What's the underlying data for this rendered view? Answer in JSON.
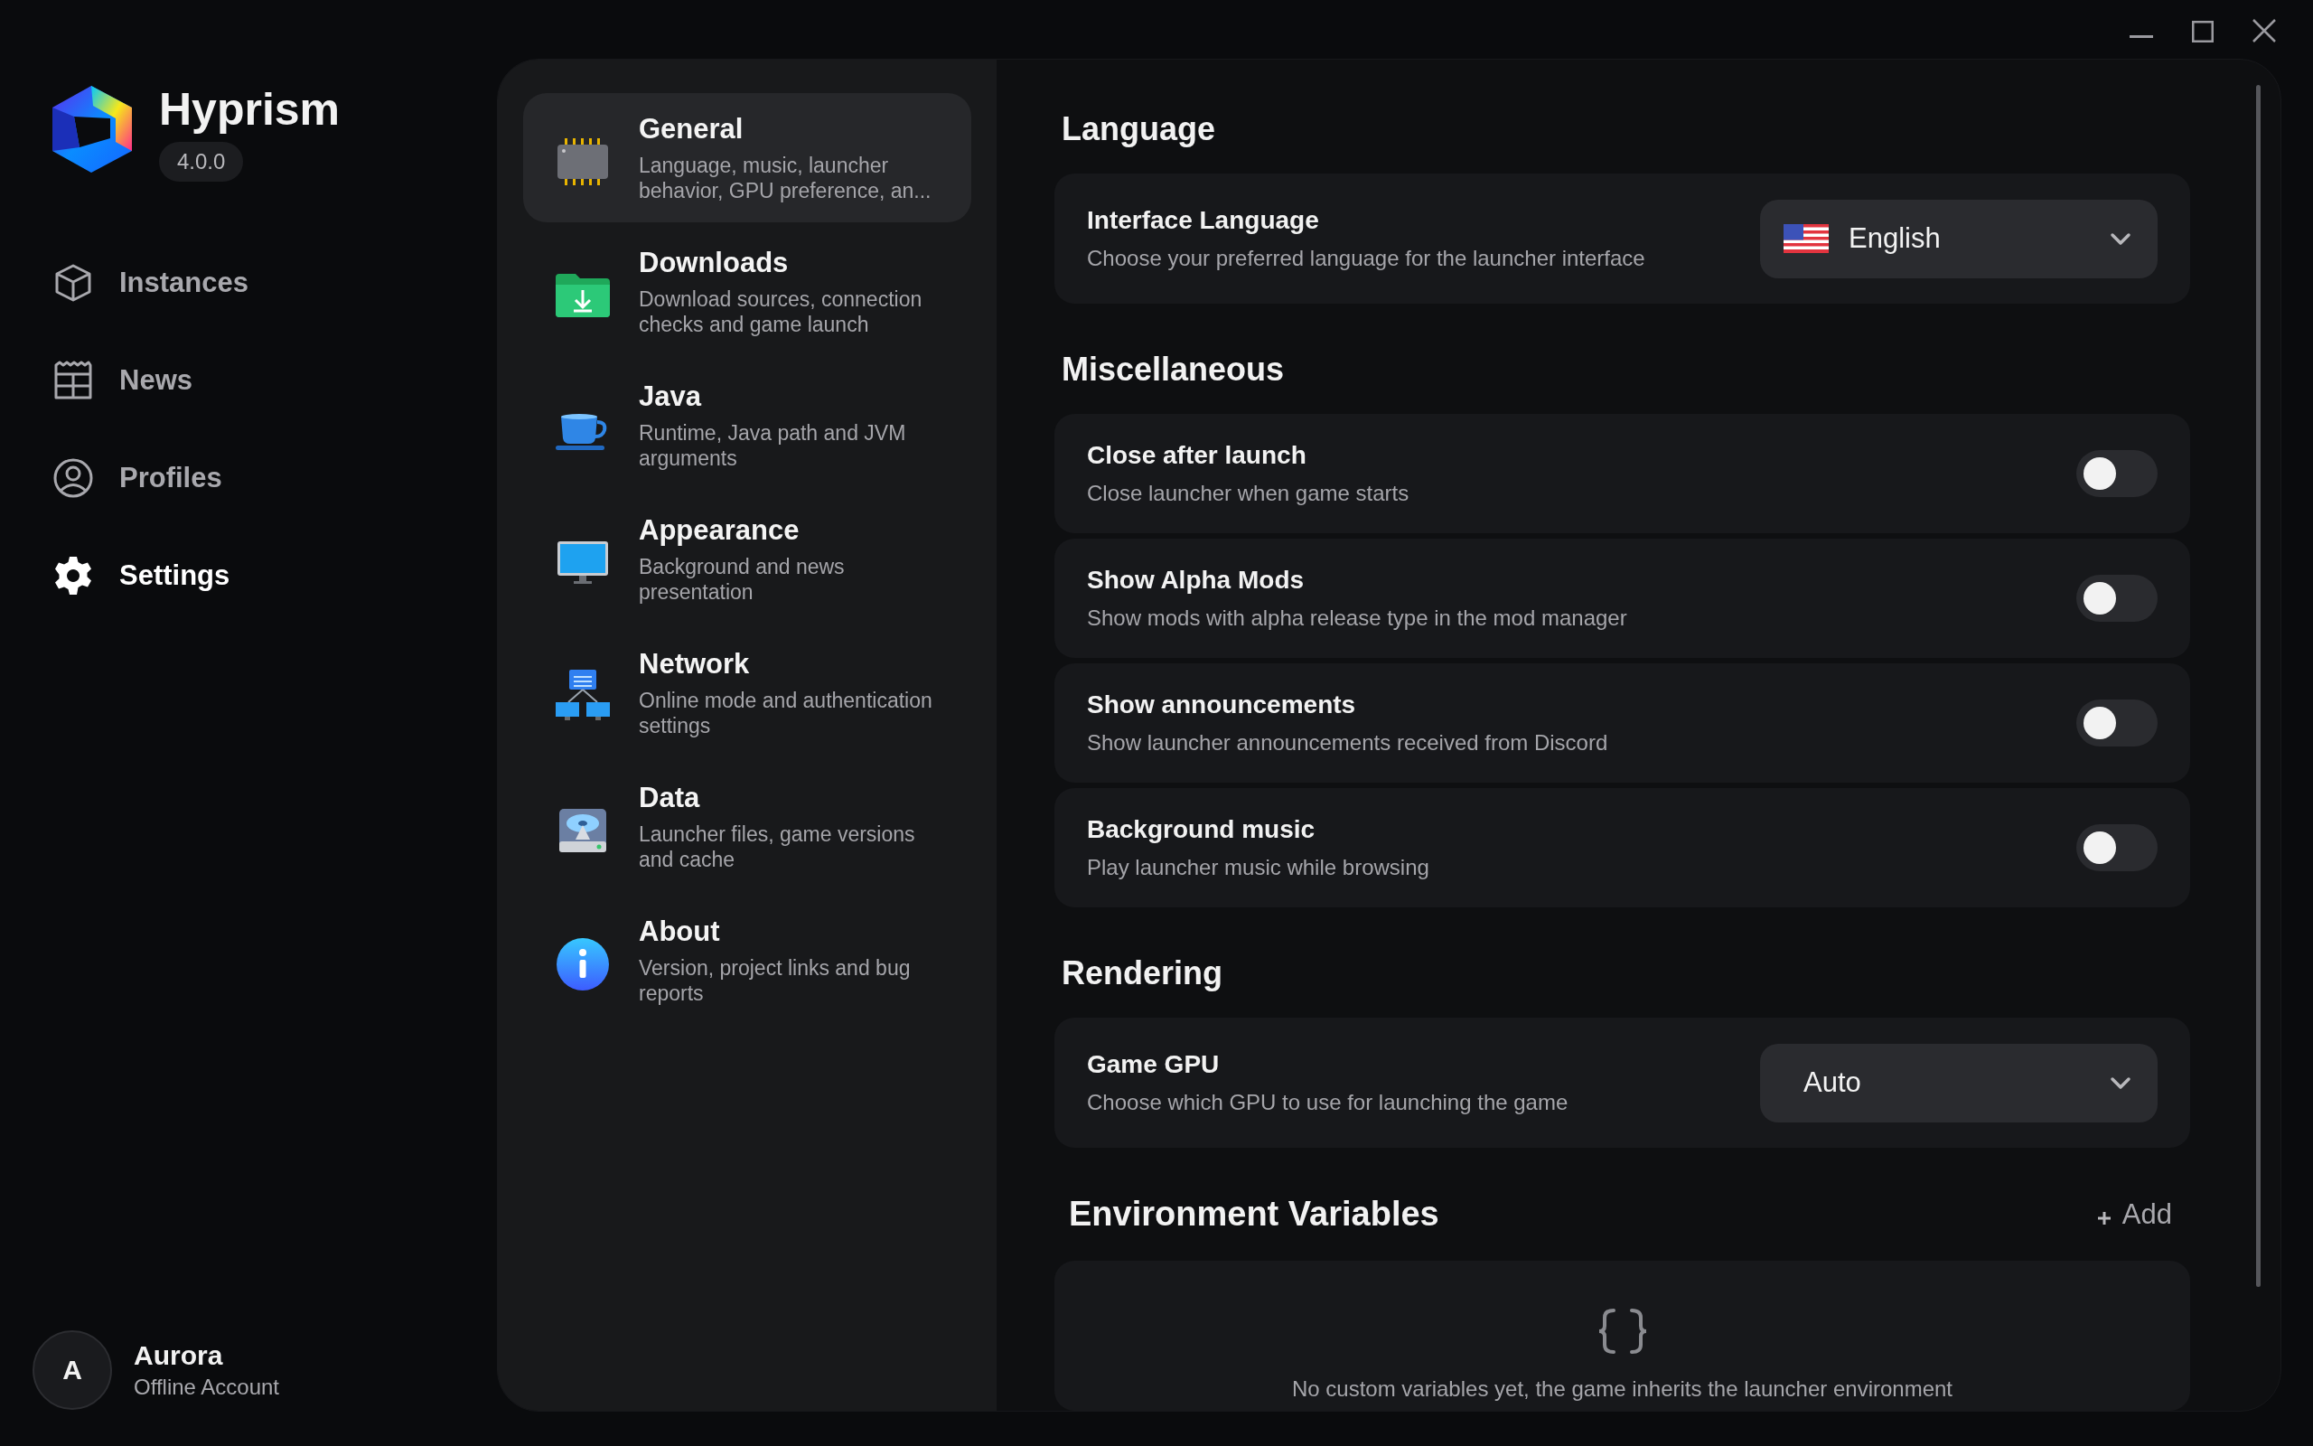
{
  "app": {
    "name": "Hyprism",
    "version": "4.0.0"
  },
  "nav": [
    {
      "label": "Instances",
      "kind": "cube",
      "selected": false
    },
    {
      "label": "News",
      "kind": "newspaper",
      "selected": false
    },
    {
      "label": "Profiles",
      "kind": "person",
      "selected": false
    },
    {
      "label": "Settings",
      "kind": "gear",
      "selected": true
    }
  ],
  "user": {
    "initial": "A",
    "name": "Aurora",
    "account": "Offline Account"
  },
  "categories": [
    {
      "title": "General",
      "description": "Language, music, launcher behavior, GPU preference, an...",
      "kind": "chip",
      "selected": true
    },
    {
      "title": "Downloads",
      "description": "Download sources, connection checks and game launch",
      "kind": "folder",
      "selected": false
    },
    {
      "title": "Java",
      "description": "Runtime, Java path and JVM arguments",
      "kind": "cup",
      "selected": false
    },
    {
      "title": "Appearance",
      "description": "Background and news presentation",
      "kind": "monitor",
      "selected": false
    },
    {
      "title": "Network",
      "description": "Online mode and authentication settings",
      "kind": "network",
      "selected": false
    },
    {
      "title": "Data",
      "description": "Launcher files, game versions and cache",
      "kind": "disk",
      "selected": false
    },
    {
      "title": "About",
      "description": "Version, project links and bug reports",
      "kind": "info",
      "selected": false
    }
  ],
  "sections": [
    {
      "heading": "Language",
      "rows": [
        {
          "kind": "language-select",
          "title": "Interface Language",
          "description": "Choose your preferred language for the launcher interface",
          "value": "English"
        }
      ]
    },
    {
      "heading": "Miscellaneous",
      "rows": [
        {
          "kind": "toggle",
          "title": "Close after launch",
          "description": "Close launcher when game starts",
          "on": false
        },
        {
          "kind": "toggle",
          "title": "Show Alpha Mods",
          "description": "Show mods with alpha release type in the mod manager",
          "on": false
        },
        {
          "kind": "toggle",
          "title": "Show announcements",
          "description": "Show launcher announcements received from Discord",
          "on": false
        },
        {
          "kind": "toggle",
          "title": "Background music",
          "description": "Play launcher music while browsing",
          "on": false
        }
      ]
    },
    {
      "heading": "Rendering",
      "rows": [
        {
          "kind": "select",
          "title": "Game GPU",
          "description": "Choose which GPU to use for launching the game",
          "value": "Auto"
        }
      ]
    }
  ],
  "environment": {
    "heading": "Environment Variables",
    "add_label": "Add",
    "empty_text": "No custom variables yet, the game inherits the launcher environment"
  }
}
